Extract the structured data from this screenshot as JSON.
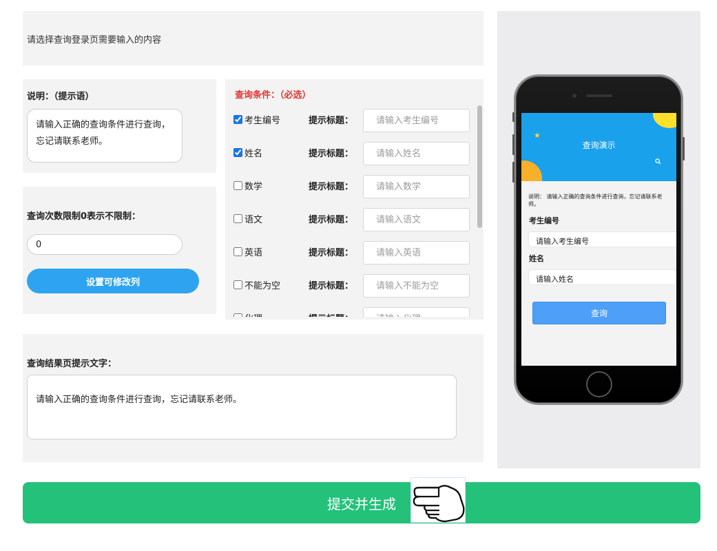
{
  "intro": {
    "text": "请选择查询登录页需要输入的内容"
  },
  "description": {
    "label": "说明：（提示语）",
    "text": "请输入正确的查询条件进行查询，忘记请联系老师。"
  },
  "limit": {
    "label": "查询次数限制0表示不限制：",
    "value": "0",
    "button_label": "设置可修改列"
  },
  "conditions": {
    "title": "查询条件：（必选）",
    "hint_label": "提示标题：",
    "items": [
      {
        "name": "考生编号",
        "checked": true,
        "placeholder": "请输入考生编号"
      },
      {
        "name": "姓名",
        "checked": true,
        "placeholder": "请输入姓名"
      },
      {
        "name": "数学",
        "checked": false,
        "placeholder": "请输入数学"
      },
      {
        "name": "语文",
        "checked": false,
        "placeholder": "请输入语文"
      },
      {
        "name": "英语",
        "checked": false,
        "placeholder": "请输入英语"
      },
      {
        "name": "不能为空",
        "checked": false,
        "placeholder": "请输入不能为空"
      },
      {
        "name": "化理",
        "checked": false,
        "placeholder": "请输入化理"
      }
    ]
  },
  "result": {
    "label": "查询结果页提示文字：",
    "text": "请输入正确的查询条件进行查询，忘记请联系老师。"
  },
  "preview": {
    "banner_title": "查询演示",
    "note": "说明： 请输入正确的查询条件进行查询，忘记请联系老师。",
    "fields": [
      {
        "label": "考生编号",
        "placeholder": "请输入考生编号"
      },
      {
        "label": "姓名",
        "placeholder": "请输入姓名"
      }
    ],
    "query_button": "查询",
    "icons": [
      "star-icon",
      "search-icon"
    ]
  },
  "submit": {
    "label": "提交并生成"
  },
  "cursor": {
    "icon": "hand-pointer-icon"
  },
  "colors": {
    "primary_blue": "#2ea4f0",
    "required_red": "#e8322f",
    "submit_green": "#24c17a",
    "banner_blue": "#1aa1ec",
    "query_blue": "#4d9ff8"
  }
}
